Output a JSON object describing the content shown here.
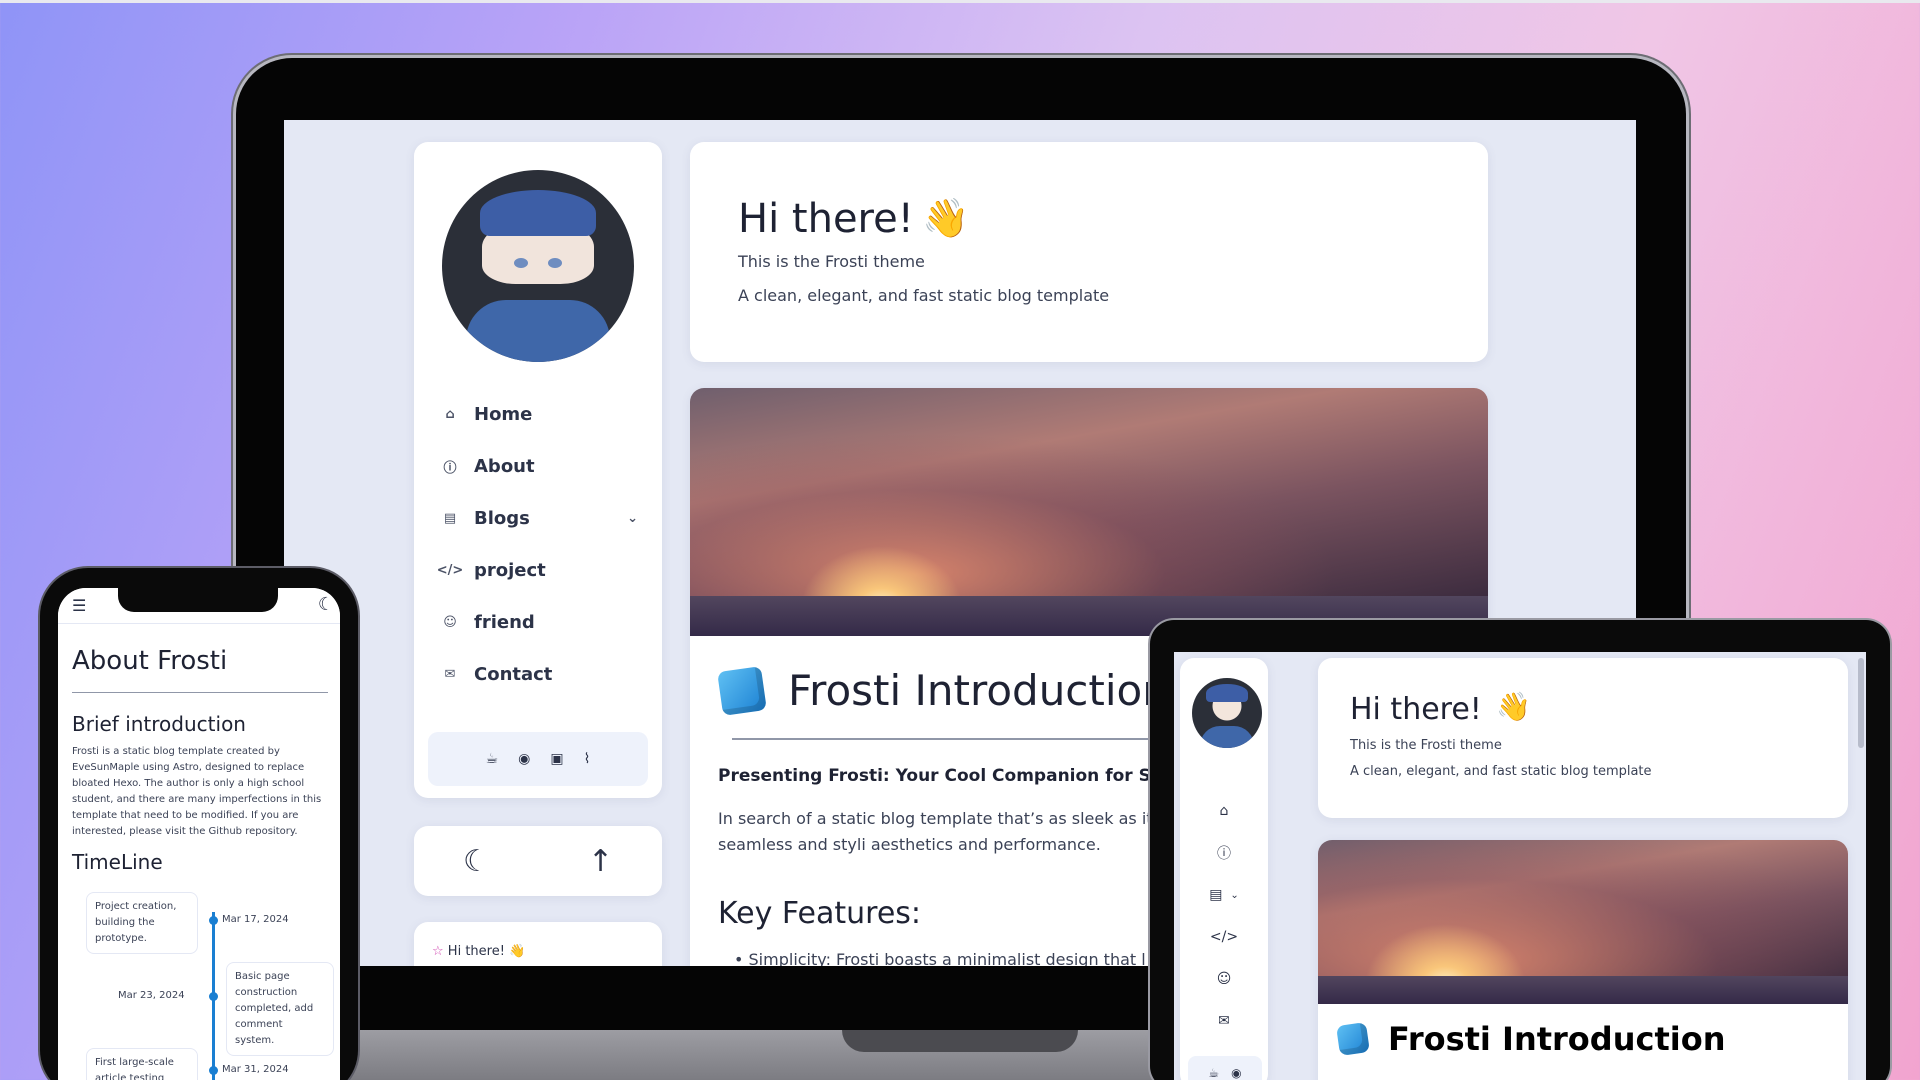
{
  "laptop": {
    "nav": [
      {
        "label": "Home",
        "icon": "home-icon"
      },
      {
        "label": "About",
        "icon": "info-icon"
      },
      {
        "label": "Blogs",
        "icon": "book-icon"
      },
      {
        "label": "project",
        "icon": "code-icon"
      },
      {
        "label": "friend",
        "icon": "users-icon"
      },
      {
        "label": "Contact",
        "icon": "mail-icon"
      }
    ],
    "hero": {
      "title": "Hi there!",
      "subtitle": "This is the Frosti theme",
      "description": "A clean, elegant, and fast static blog template"
    },
    "post": {
      "title": "Frosti Introduction",
      "lead": "Presenting Frosti: Your Cool Companion for Static",
      "paragraph": "In search of a static blog template that’s as sleek as it i Developed with Astro, Frosti offers a seamless and styli aesthetics and performance.",
      "heading": "Key Features:",
      "bullet": "• Simplicity: Frosti boasts a minimalist design that l"
    },
    "mini_card": "Hi there!"
  },
  "phone": {
    "title": "About Frosti",
    "brief_heading": "Brief introduction",
    "brief_text": "Frosti is a static blog template created by EveSunMaple using Astro, designed to replace bloated Hexo. The author is only a high school student, and there are many imperfections in this template that need to be modified. If you are interested, please visit the Github repository.",
    "timeline_heading": "TimeLine",
    "timeline": [
      {
        "text": "Project creation, building the prototype.",
        "date": "Mar 17, 2024"
      },
      {
        "text": "Basic page construction completed, add comment system.",
        "date": "Mar 23, 2024"
      },
      {
        "text": "First large-scale article testing",
        "date": "Mar 31, 2024"
      }
    ]
  },
  "tablet": {
    "hero": {
      "title": "Hi there!",
      "subtitle": "This is the Frosti theme",
      "description": "A clean, elegant, and fast static blog template"
    },
    "post_title": "Frosti Introduction"
  },
  "colors": {
    "accent": "#1a7fd2",
    "text": "#1e2233",
    "background": "#e4e8f4"
  }
}
